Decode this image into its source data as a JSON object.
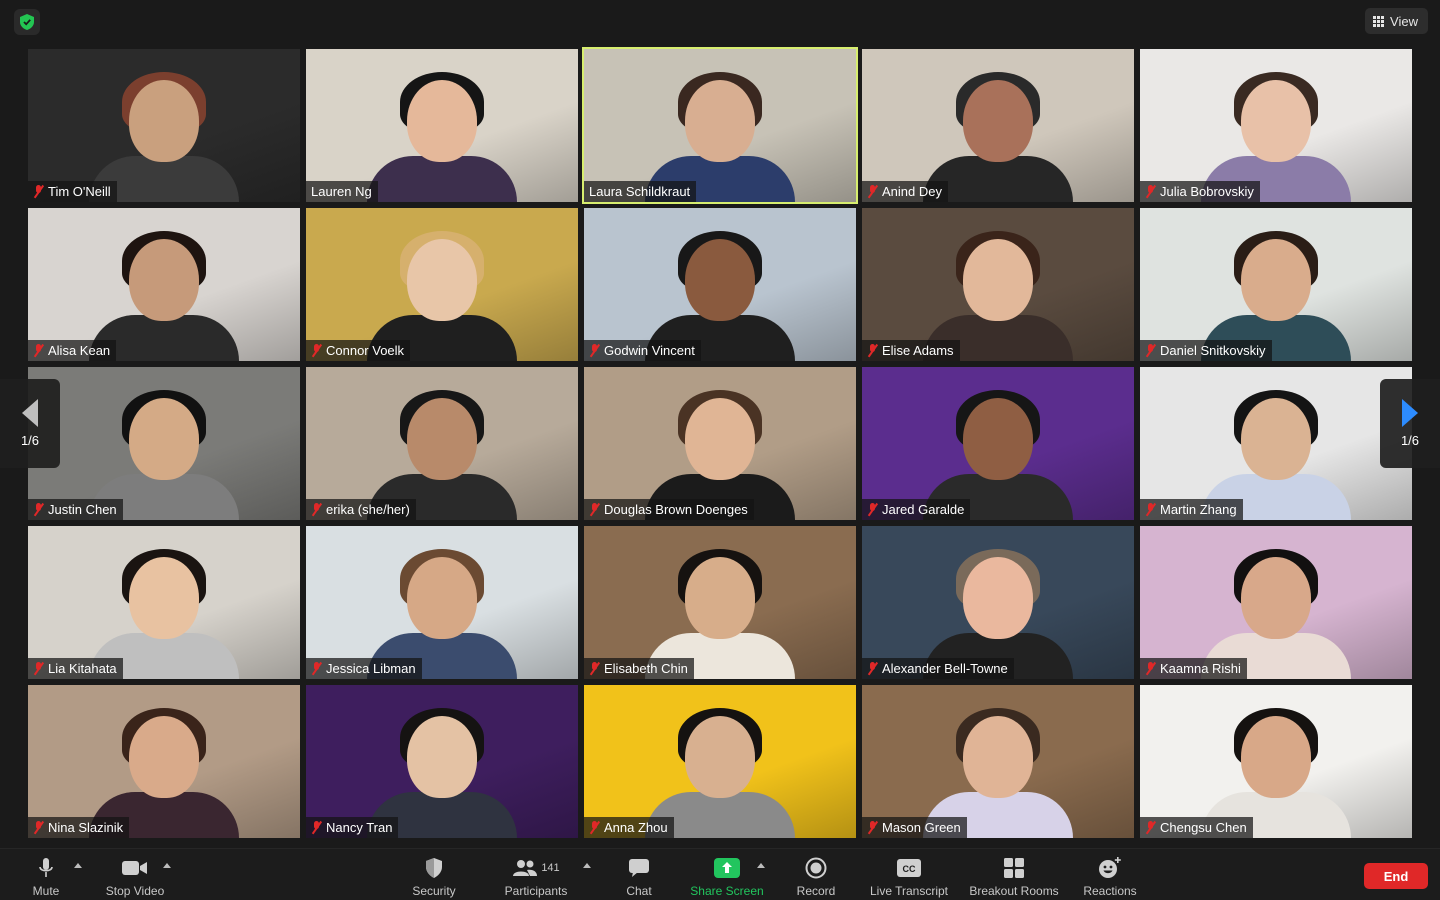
{
  "top_bar": {
    "view_label": "View"
  },
  "colors": {
    "active_border": "#d7ee6f",
    "muted_red": "#e02828",
    "share_green": "#22c55e",
    "pager_blue": "#2d8cff",
    "end_red": "#e02828"
  },
  "pager": {
    "left_label": "1/6",
    "right_label": "1/6"
  },
  "participants": [
    {
      "name": "Tim O'Neill",
      "muted": true,
      "active": false
    },
    {
      "name": "Lauren Ng",
      "muted": false,
      "active": false
    },
    {
      "name": "Laura Schildkraut",
      "muted": false,
      "active": true
    },
    {
      "name": "Anind Dey",
      "muted": true,
      "active": false
    },
    {
      "name": "Julia Bobrovskiy",
      "muted": true,
      "active": false
    },
    {
      "name": "Alisa Kean",
      "muted": true,
      "active": false
    },
    {
      "name": "Connor Voelk",
      "muted": true,
      "active": false
    },
    {
      "name": "Godwin Vincent",
      "muted": true,
      "active": false
    },
    {
      "name": "Elise Adams",
      "muted": true,
      "active": false
    },
    {
      "name": "Daniel Snitkovskiy",
      "muted": true,
      "active": false
    },
    {
      "name": "Justin Chen",
      "muted": true,
      "active": false
    },
    {
      "name": "erika (she/her)",
      "muted": true,
      "active": false
    },
    {
      "name": "Douglas Brown Doenges",
      "muted": true,
      "active": false
    },
    {
      "name": "Jared Garalde",
      "muted": true,
      "active": false
    },
    {
      "name": "Martin Zhang",
      "muted": true,
      "active": false
    },
    {
      "name": "Lia Kitahata",
      "muted": true,
      "active": false
    },
    {
      "name": "Jessica Libman",
      "muted": true,
      "active": false
    },
    {
      "name": "Elisabeth Chin",
      "muted": true,
      "active": false
    },
    {
      "name": "Alexander Bell-Towne",
      "muted": true,
      "active": false
    },
    {
      "name": "Kaamna Rishi",
      "muted": true,
      "active": false
    },
    {
      "name": "Nina Slazinik",
      "muted": true,
      "active": false
    },
    {
      "name": "Nancy Tran",
      "muted": true,
      "active": false
    },
    {
      "name": "Anna Zhou",
      "muted": true,
      "active": false
    },
    {
      "name": "Mason Green",
      "muted": true,
      "active": false
    },
    {
      "name": "Chengsu Chen",
      "muted": true,
      "active": false
    }
  ],
  "toolbar": {
    "mute": "Mute",
    "stop_video": "Stop Video",
    "security": "Security",
    "participants": "Participants",
    "participants_count": "141",
    "chat": "Chat",
    "share_screen": "Share Screen",
    "record": "Record",
    "live_transcript": "Live Transcript",
    "breakout_rooms": "Breakout Rooms",
    "reactions": "Reactions",
    "end": "End"
  }
}
